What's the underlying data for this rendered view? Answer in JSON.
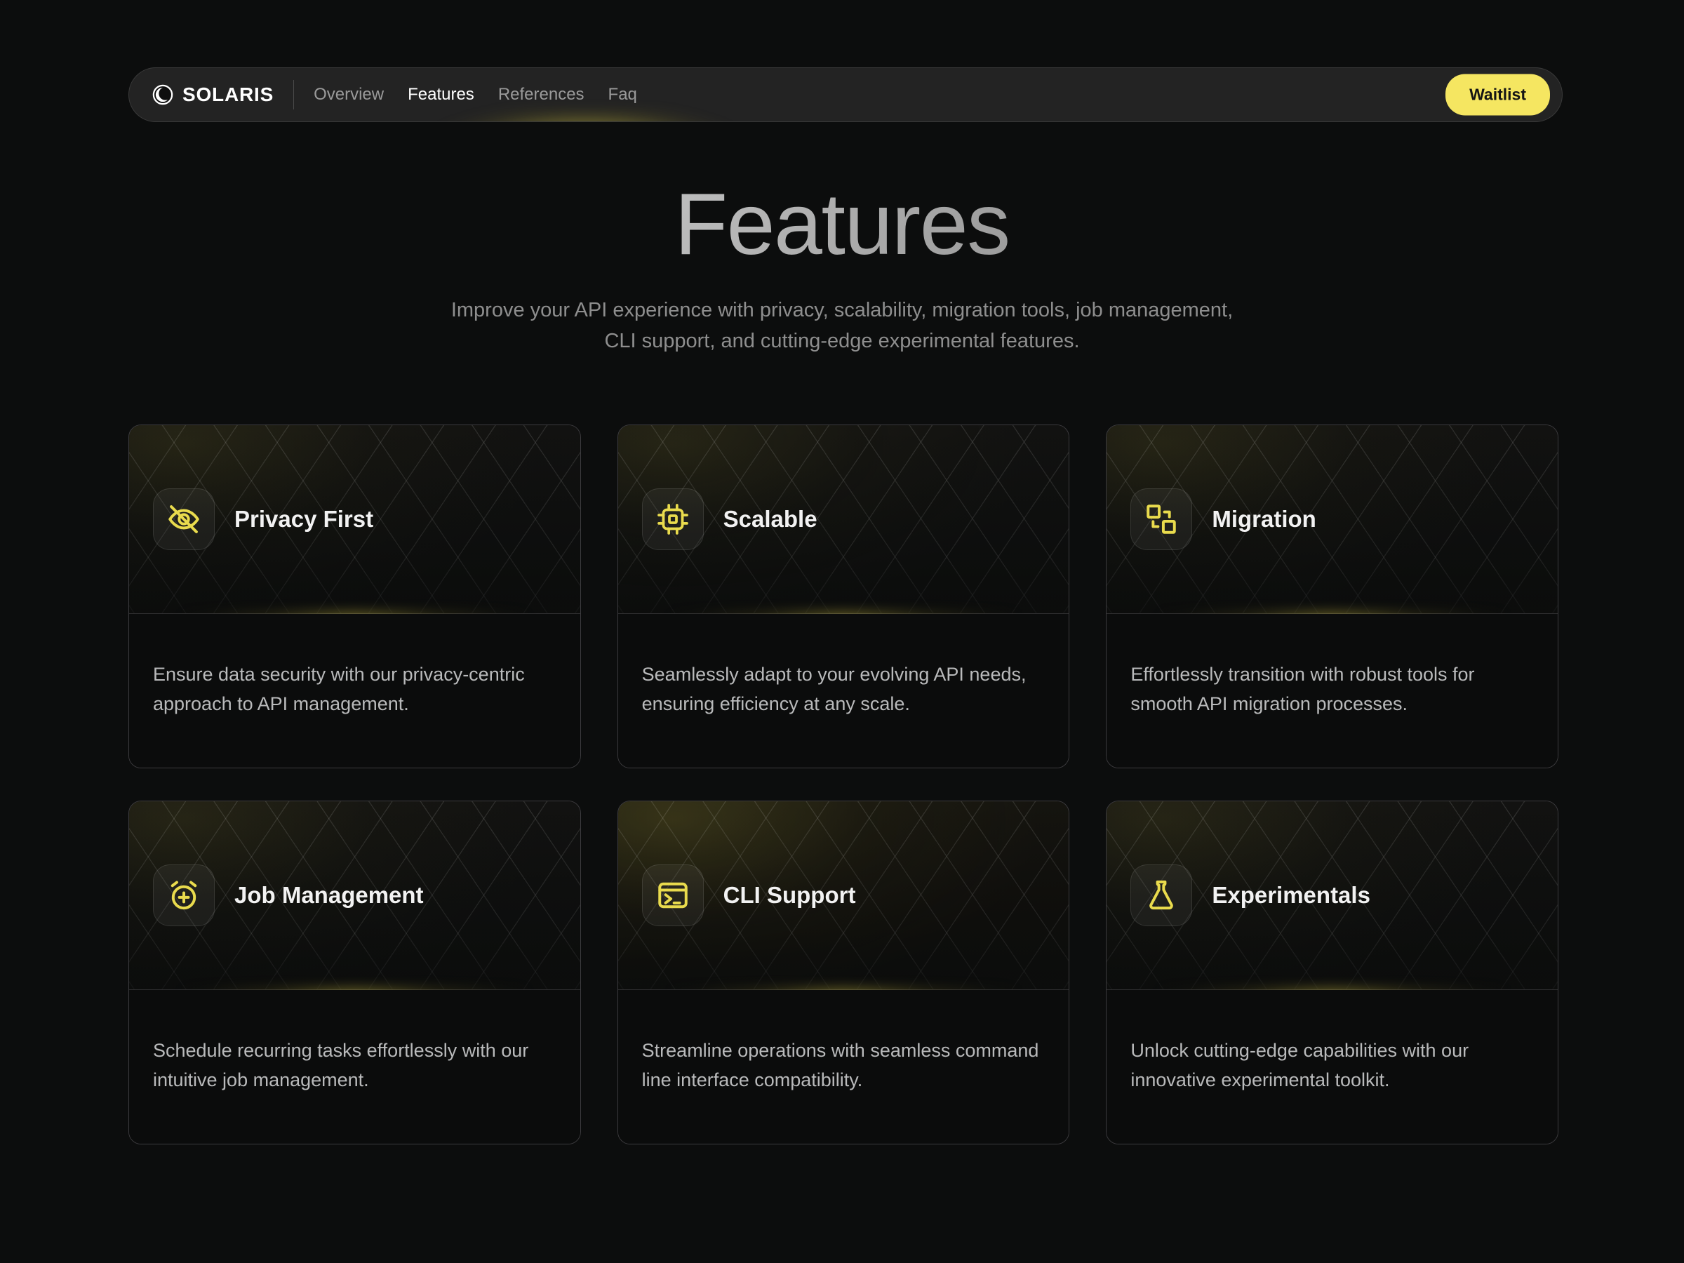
{
  "nav": {
    "brand": "SOLARIS",
    "brand_icon": "crescent-moon-icon",
    "links": [
      {
        "label": "Overview",
        "active": false
      },
      {
        "label": "Features",
        "active": true
      },
      {
        "label": "References",
        "active": false
      },
      {
        "label": "Faq",
        "active": false
      }
    ],
    "cta": "Waitlist"
  },
  "hero": {
    "title": "Features",
    "subtitle": "Improve your API experience with privacy, scalability, migration tools, job management, CLI support, and cutting-edge experimental features."
  },
  "cards": [
    {
      "icon": "eye-off-icon",
      "title": "Privacy First",
      "description": "Ensure data security with our privacy-centric approach to API management."
    },
    {
      "icon": "cpu-chip-icon",
      "title": "Scalable",
      "description": "Seamlessly adapt to your evolving API needs, ensuring efficiency at any scale."
    },
    {
      "icon": "migration-squares-icon",
      "title": "Migration",
      "description": "Effortlessly transition with robust tools for smooth API migration processes."
    },
    {
      "icon": "alarm-plus-icon",
      "title": "Job Management",
      "description": "Schedule recurring tasks effortlessly with our intuitive job management."
    },
    {
      "icon": "terminal-icon",
      "title": "CLI Support",
      "description": "Streamline operations with seamless command line interface compatibility."
    },
    {
      "icon": "flask-icon",
      "title": "Experimentals",
      "description": "Unlock cutting-edge capabilities with our innovative experimental toolkit."
    }
  ],
  "colors": {
    "accent": "#f5e661",
    "icon_yellow": "#e9db4d",
    "page_bg": "#0c0d0d",
    "navbar_bg": "#232323",
    "card_border": "#3c3b3e",
    "title_text": "#f2f2f2",
    "body_text": "#b9babb",
    "muted_text": "#8e8e8e"
  }
}
